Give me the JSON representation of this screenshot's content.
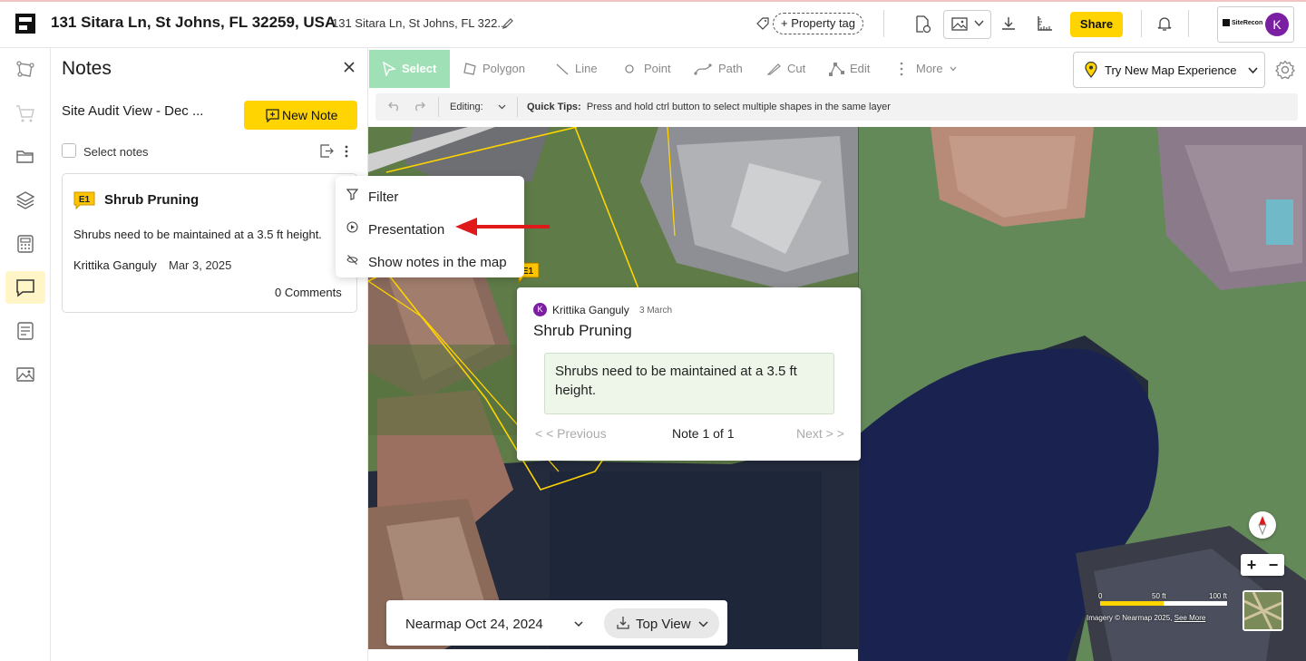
{
  "header": {
    "address_title": "131 Sitara Ln, St Johns, FL 32259, USA",
    "address_sub": "131 Sitara Ln, St Johns, FL 322...",
    "property_tag": "+ Property tag",
    "share": "Share",
    "brand": "SiteRecon",
    "avatar_initial": "K"
  },
  "rail": {
    "items": [
      "properties-icon",
      "cart-icon",
      "folder-icon",
      "layers-icon",
      "calculator-icon",
      "notes-icon",
      "report-icon",
      "gallery-icon"
    ]
  },
  "notes_panel": {
    "title": "Notes",
    "view_name": "Site Audit View - Dec ...",
    "new_note": "New Note",
    "select_notes": "Select notes",
    "card": {
      "badge": "E1",
      "title": "Shrub Pruning",
      "body": "Shrubs need to be maintained at a 3.5 ft height.",
      "author": "Krittika Ganguly",
      "date": "Mar 3, 2025",
      "comments": "0 Comments"
    }
  },
  "menu": {
    "items": [
      {
        "label": "Filter",
        "icon": "filter-icon"
      },
      {
        "label": "Presentation",
        "icon": "presentation-icon"
      },
      {
        "label": "Show notes in the map",
        "icon": "eye-off-icon"
      }
    ]
  },
  "toolbar": {
    "tools": [
      "Select",
      "Polygon",
      "Line",
      "Point",
      "Path",
      "Cut",
      "Edit",
      "More"
    ],
    "try_map": "Try New Map Experience",
    "editing": "Editing:",
    "quick_tips_label": "Quick Tips:",
    "quick_tips_text": "Press and hold ctrl button to select multiple shapes in the same layer"
  },
  "popup": {
    "avatar_initial": "K",
    "author": "Krittika Ganguly",
    "date": "3 March",
    "title": "Shrub Pruning",
    "body": "Shrubs need to be maintained at a 3.5 ft height.",
    "prev": "< < Previous",
    "count": "Note 1 of 1",
    "next": "Next > >",
    "marker": "E1"
  },
  "map_controls": {
    "imagery_date": "Nearmap Oct 24, 2024",
    "view": "Top View",
    "scale_labels": [
      "0",
      "50 ft",
      "100 ft"
    ],
    "attribution": "Imagery © Nearmap 2025,",
    "attribution_link": "See More",
    "zoom_in": "+",
    "zoom_out": "−"
  },
  "colors": {
    "accent_yellow": "#ffd400",
    "select_green": "#9fe0b6",
    "avatar_purple": "#7b1fa2",
    "annotation_red": "#e01a1a"
  }
}
